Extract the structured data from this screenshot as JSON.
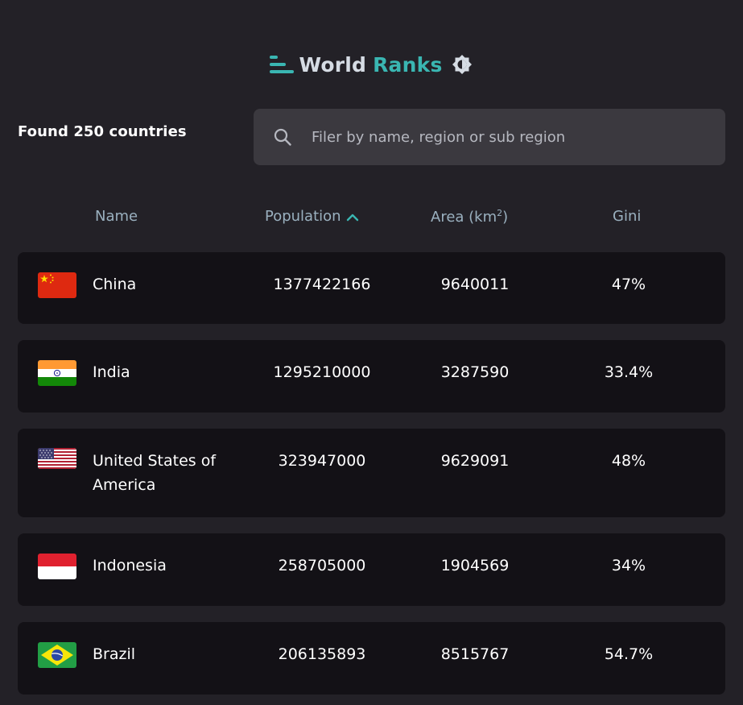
{
  "header": {
    "title_part1": "World",
    "title_part2": "Ranks",
    "accent_color": "#3ab6b2",
    "logo_icon": "bars-icon",
    "theme_icon": "theme-toggle-icon"
  },
  "summary": {
    "found_text": "Found 250 countries"
  },
  "search": {
    "placeholder": "Filer by name, region or sub region",
    "value": "",
    "icon": "search-icon"
  },
  "table": {
    "columns": {
      "name": "Name",
      "population": "Population",
      "area": "Area (km",
      "area_sup": "2",
      "area_close": ")",
      "gini": "Gini"
    },
    "sort": {
      "column": "population",
      "icon": "chevron-up-icon"
    },
    "rows": [
      {
        "name": "China",
        "population": "1377422166",
        "area": "9640011",
        "gini": "47%",
        "flag": "china-flag"
      },
      {
        "name": "India",
        "population": "1295210000",
        "area": "3287590",
        "gini": "33.4%",
        "flag": "india-flag"
      },
      {
        "name": "United States of America",
        "population": "323947000",
        "area": "9629091",
        "gini": "48%",
        "flag": "usa-flag"
      },
      {
        "name": "Indonesia",
        "population": "258705000",
        "area": "1904569",
        "gini": "34%",
        "flag": "indonesia-flag"
      },
      {
        "name": "Brazil",
        "population": "206135893",
        "area": "8515767",
        "gini": "54.7%",
        "flag": "brazil-flag"
      }
    ]
  }
}
